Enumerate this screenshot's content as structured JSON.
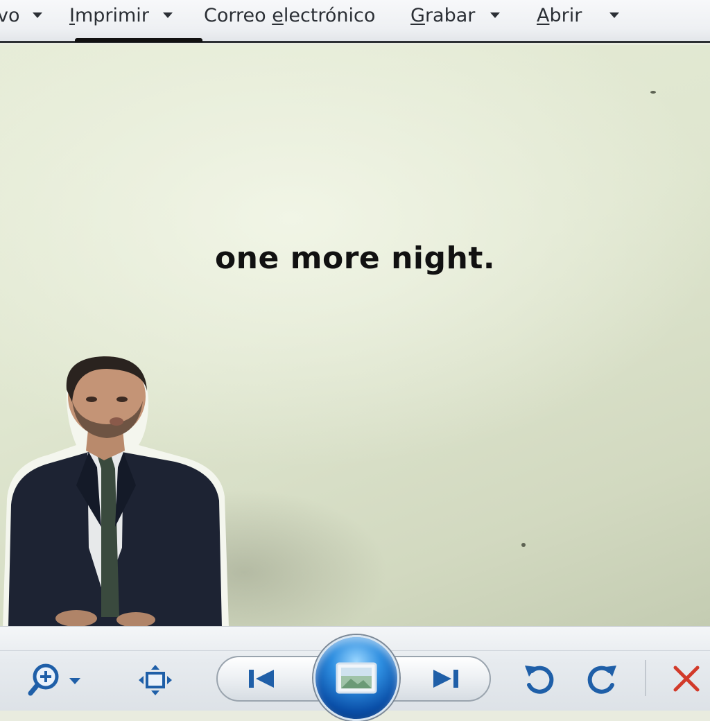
{
  "menu": {
    "items": [
      {
        "key": "archivo",
        "label_pre": "",
        "label_u": "",
        "label_post": "vo"
      },
      {
        "key": "imprimir",
        "label_pre": "",
        "label_u": "I",
        "label_post": "mprimir"
      },
      {
        "key": "correo",
        "label_pre": "Correo ",
        "label_u": "e",
        "label_post": "lectrónico"
      },
      {
        "key": "grabar",
        "label_pre": "",
        "label_u": "G",
        "label_post": "rabar"
      },
      {
        "key": "abrir",
        "label_pre": "",
        "label_u": "A",
        "label_post": "brir"
      }
    ]
  },
  "viewer": {
    "caption": "one more night."
  },
  "toolbar": {
    "zoom_icon": "magnifier-plus-icon",
    "fit_icon": "actual-size-icon",
    "prev_icon": "previous-icon",
    "slideshow_icon": "slideshow-icon",
    "next_icon": "next-icon",
    "rotate_ccw_icon": "rotate-left-icon",
    "rotate_cw_icon": "rotate-right-icon",
    "delete_icon": "delete-x-icon"
  },
  "colors": {
    "accent_blue": "#1f5fa8",
    "delete_red": "#d23a2a",
    "menu_text": "#2b2f35",
    "wall": "#dfe6cf"
  }
}
